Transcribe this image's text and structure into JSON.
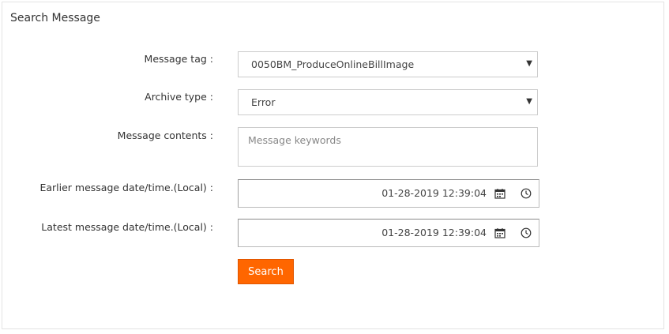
{
  "panel": {
    "title": "Search Message"
  },
  "form": {
    "message_tag": {
      "label": "Message tag :",
      "value": "0050BM_ProduceOnlineBillImage"
    },
    "archive_type": {
      "label": "Archive type :",
      "value": "Error"
    },
    "message_contents": {
      "label": "Message contents :",
      "placeholder": "Message keywords",
      "value": ""
    },
    "earlier_datetime": {
      "label": "Earlier message date/time.(Local) :",
      "value": "01-28-2019 12:39:04"
    },
    "latest_datetime": {
      "label": "Latest message date/time.(Local) :",
      "value": "01-28-2019 12:39:04"
    },
    "search_button": {
      "label": "Search"
    }
  },
  "icons": {
    "dropdown": "chevron-down-icon",
    "calendar": "calendar-icon",
    "clock": "clock-icon"
  },
  "colors": {
    "accent": "#ff6600",
    "border": "#cccccc",
    "text": "#333333"
  }
}
